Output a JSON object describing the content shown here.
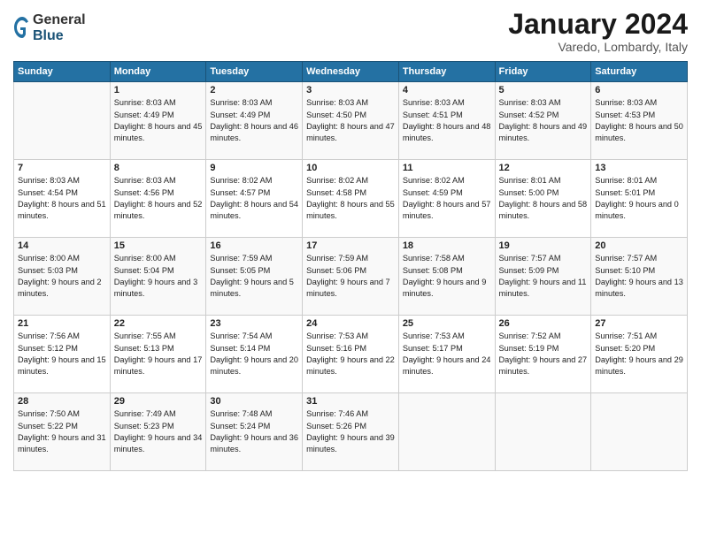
{
  "header": {
    "logo": {
      "general": "General",
      "blue": "Blue"
    },
    "title": "January 2024",
    "location": "Varedo, Lombardy, Italy"
  },
  "columns": [
    "Sunday",
    "Monday",
    "Tuesday",
    "Wednesday",
    "Thursday",
    "Friday",
    "Saturday"
  ],
  "weeks": [
    [
      {
        "day": "",
        "sunrise": "",
        "sunset": "",
        "daylight": ""
      },
      {
        "day": "1",
        "sunrise": "Sunrise: 8:03 AM",
        "sunset": "Sunset: 4:49 PM",
        "daylight": "Daylight: 8 hours and 45 minutes."
      },
      {
        "day": "2",
        "sunrise": "Sunrise: 8:03 AM",
        "sunset": "Sunset: 4:49 PM",
        "daylight": "Daylight: 8 hours and 46 minutes."
      },
      {
        "day": "3",
        "sunrise": "Sunrise: 8:03 AM",
        "sunset": "Sunset: 4:50 PM",
        "daylight": "Daylight: 8 hours and 47 minutes."
      },
      {
        "day": "4",
        "sunrise": "Sunrise: 8:03 AM",
        "sunset": "Sunset: 4:51 PM",
        "daylight": "Daylight: 8 hours and 48 minutes."
      },
      {
        "day": "5",
        "sunrise": "Sunrise: 8:03 AM",
        "sunset": "Sunset: 4:52 PM",
        "daylight": "Daylight: 8 hours and 49 minutes."
      },
      {
        "day": "6",
        "sunrise": "Sunrise: 8:03 AM",
        "sunset": "Sunset: 4:53 PM",
        "daylight": "Daylight: 8 hours and 50 minutes."
      }
    ],
    [
      {
        "day": "7",
        "sunrise": "Sunrise: 8:03 AM",
        "sunset": "Sunset: 4:54 PM",
        "daylight": "Daylight: 8 hours and 51 minutes."
      },
      {
        "day": "8",
        "sunrise": "Sunrise: 8:03 AM",
        "sunset": "Sunset: 4:56 PM",
        "daylight": "Daylight: 8 hours and 52 minutes."
      },
      {
        "day": "9",
        "sunrise": "Sunrise: 8:02 AM",
        "sunset": "Sunset: 4:57 PM",
        "daylight": "Daylight: 8 hours and 54 minutes."
      },
      {
        "day": "10",
        "sunrise": "Sunrise: 8:02 AM",
        "sunset": "Sunset: 4:58 PM",
        "daylight": "Daylight: 8 hours and 55 minutes."
      },
      {
        "day": "11",
        "sunrise": "Sunrise: 8:02 AM",
        "sunset": "Sunset: 4:59 PM",
        "daylight": "Daylight: 8 hours and 57 minutes."
      },
      {
        "day": "12",
        "sunrise": "Sunrise: 8:01 AM",
        "sunset": "Sunset: 5:00 PM",
        "daylight": "Daylight: 8 hours and 58 minutes."
      },
      {
        "day": "13",
        "sunrise": "Sunrise: 8:01 AM",
        "sunset": "Sunset: 5:01 PM",
        "daylight": "Daylight: 9 hours and 0 minutes."
      }
    ],
    [
      {
        "day": "14",
        "sunrise": "Sunrise: 8:00 AM",
        "sunset": "Sunset: 5:03 PM",
        "daylight": "Daylight: 9 hours and 2 minutes."
      },
      {
        "day": "15",
        "sunrise": "Sunrise: 8:00 AM",
        "sunset": "Sunset: 5:04 PM",
        "daylight": "Daylight: 9 hours and 3 minutes."
      },
      {
        "day": "16",
        "sunrise": "Sunrise: 7:59 AM",
        "sunset": "Sunset: 5:05 PM",
        "daylight": "Daylight: 9 hours and 5 minutes."
      },
      {
        "day": "17",
        "sunrise": "Sunrise: 7:59 AM",
        "sunset": "Sunset: 5:06 PM",
        "daylight": "Daylight: 9 hours and 7 minutes."
      },
      {
        "day": "18",
        "sunrise": "Sunrise: 7:58 AM",
        "sunset": "Sunset: 5:08 PM",
        "daylight": "Daylight: 9 hours and 9 minutes."
      },
      {
        "day": "19",
        "sunrise": "Sunrise: 7:57 AM",
        "sunset": "Sunset: 5:09 PM",
        "daylight": "Daylight: 9 hours and 11 minutes."
      },
      {
        "day": "20",
        "sunrise": "Sunrise: 7:57 AM",
        "sunset": "Sunset: 5:10 PM",
        "daylight": "Daylight: 9 hours and 13 minutes."
      }
    ],
    [
      {
        "day": "21",
        "sunrise": "Sunrise: 7:56 AM",
        "sunset": "Sunset: 5:12 PM",
        "daylight": "Daylight: 9 hours and 15 minutes."
      },
      {
        "day": "22",
        "sunrise": "Sunrise: 7:55 AM",
        "sunset": "Sunset: 5:13 PM",
        "daylight": "Daylight: 9 hours and 17 minutes."
      },
      {
        "day": "23",
        "sunrise": "Sunrise: 7:54 AM",
        "sunset": "Sunset: 5:14 PM",
        "daylight": "Daylight: 9 hours and 20 minutes."
      },
      {
        "day": "24",
        "sunrise": "Sunrise: 7:53 AM",
        "sunset": "Sunset: 5:16 PM",
        "daylight": "Daylight: 9 hours and 22 minutes."
      },
      {
        "day": "25",
        "sunrise": "Sunrise: 7:53 AM",
        "sunset": "Sunset: 5:17 PM",
        "daylight": "Daylight: 9 hours and 24 minutes."
      },
      {
        "day": "26",
        "sunrise": "Sunrise: 7:52 AM",
        "sunset": "Sunset: 5:19 PM",
        "daylight": "Daylight: 9 hours and 27 minutes."
      },
      {
        "day": "27",
        "sunrise": "Sunrise: 7:51 AM",
        "sunset": "Sunset: 5:20 PM",
        "daylight": "Daylight: 9 hours and 29 minutes."
      }
    ],
    [
      {
        "day": "28",
        "sunrise": "Sunrise: 7:50 AM",
        "sunset": "Sunset: 5:22 PM",
        "daylight": "Daylight: 9 hours and 31 minutes."
      },
      {
        "day": "29",
        "sunrise": "Sunrise: 7:49 AM",
        "sunset": "Sunset: 5:23 PM",
        "daylight": "Daylight: 9 hours and 34 minutes."
      },
      {
        "day": "30",
        "sunrise": "Sunrise: 7:48 AM",
        "sunset": "Sunset: 5:24 PM",
        "daylight": "Daylight: 9 hours and 36 minutes."
      },
      {
        "day": "31",
        "sunrise": "Sunrise: 7:46 AM",
        "sunset": "Sunset: 5:26 PM",
        "daylight": "Daylight: 9 hours and 39 minutes."
      },
      {
        "day": "",
        "sunrise": "",
        "sunset": "",
        "daylight": ""
      },
      {
        "day": "",
        "sunrise": "",
        "sunset": "",
        "daylight": ""
      },
      {
        "day": "",
        "sunrise": "",
        "sunset": "",
        "daylight": ""
      }
    ]
  ]
}
